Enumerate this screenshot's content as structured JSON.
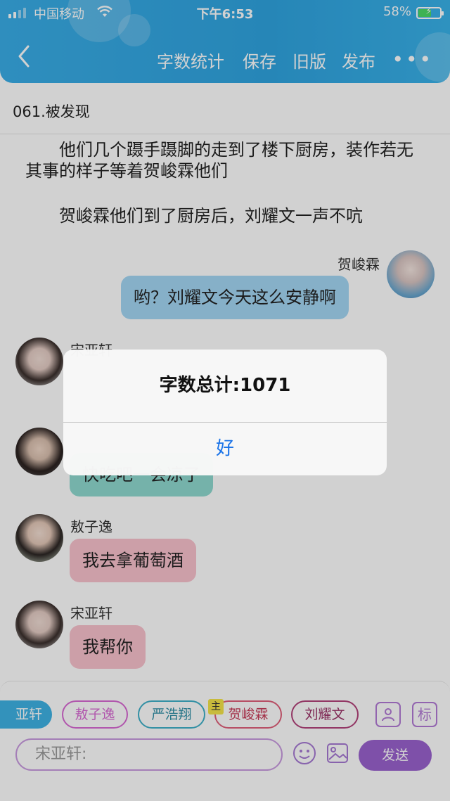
{
  "status_bar": {
    "carrier": "中国移动",
    "time": "下午6:53",
    "battery_percent": "58%"
  },
  "header": {
    "actions": [
      "字数统计",
      "保存",
      "旧版",
      "发布"
    ],
    "more_label": "•••"
  },
  "chapter_title": "061.被发现",
  "paragraphs": [
    "他们几个蹑手蹑脚的走到了楼下厨房，装作若无其事的样子等着贺峻霖他们",
    "贺峻霖他们到了厨房后，刘耀文一声不吭"
  ],
  "messages": [
    {
      "speaker": "贺峻霖",
      "text": "哟？刘耀文今天这么安静啊",
      "side": "right",
      "color": "#a4d7f5"
    },
    {
      "speaker": "宋亚轩",
      "text": "",
      "side": "left",
      "color": "#ffffff"
    },
    {
      "speaker": "",
      "text": "快吃吧一会凉了",
      "side": "left",
      "color": "#8fdad0"
    },
    {
      "speaker": "敖子逸",
      "text": "我去拿葡萄酒",
      "side": "left",
      "color": "#f9c2ce"
    },
    {
      "speaker": "宋亚轩",
      "text": "我帮你",
      "side": "left",
      "color": "#f9c2ce"
    }
  ],
  "characters": {
    "active": "亚轩",
    "list": [
      {
        "name": "敖子逸",
        "color": "#d86ad3"
      },
      {
        "name": "严浩翔",
        "color": "#3fb0c9"
      },
      {
        "name": "贺峻霖",
        "color": "#e0607a"
      },
      {
        "name": "刘耀文",
        "color": "#b2427a"
      }
    ],
    "main_badge": "主"
  },
  "input": {
    "placeholder": "宋亚轩:",
    "send_label": "发送"
  },
  "toolbar_icons": {
    "tag_label": "标"
  },
  "dialog": {
    "title": "字数总计:1071",
    "ok_label": "好"
  }
}
